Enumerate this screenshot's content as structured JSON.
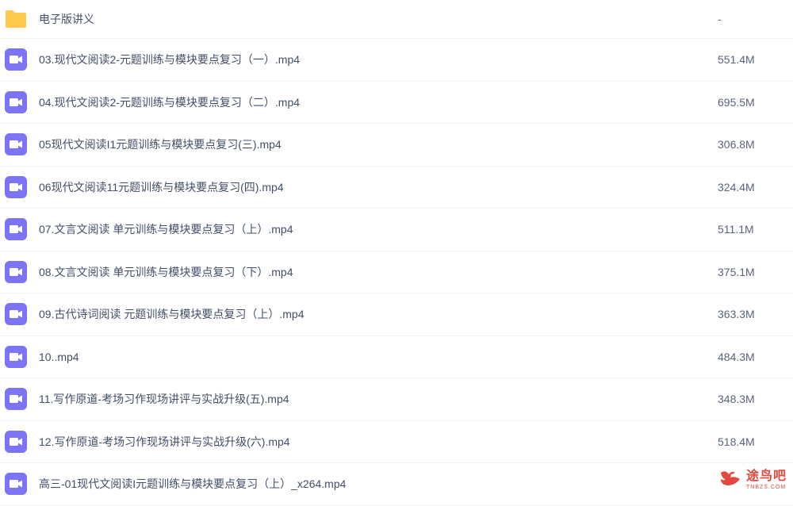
{
  "colors": {
    "folder": "#ffc94d",
    "video_icon": "#7b74f4",
    "text": "#424e67",
    "size_text": "#5a6478",
    "watermark": "#e2483c"
  },
  "files": [
    {
      "name": "电子版讲义",
      "size": "-",
      "icon": "folder-icon"
    },
    {
      "name": "03.现代文阅读2-元题训练与模块要点复习（一）.mp4",
      "size": "551.4M",
      "icon": "video-icon"
    },
    {
      "name": "04.现代文阅读2-元题训练与模块要点复习（二）.mp4",
      "size": "695.5M",
      "icon": "video-icon"
    },
    {
      "name": "05现代文阅读I1元题训练与模块要点复习(三).mp4",
      "size": "306.8M",
      "icon": "video-icon"
    },
    {
      "name": "06现代文阅读11元题训练与模块要点复习(四).mp4",
      "size": "324.4M",
      "icon": "video-icon"
    },
    {
      "name": "07.文言文阅读 单元训练与模块要点复习（上）.mp4",
      "size": "511.1M",
      "icon": "video-icon"
    },
    {
      "name": "08.文言文阅读 单元训练与模块要点复习（下）.mp4",
      "size": "375.1M",
      "icon": "video-icon"
    },
    {
      "name": "09.古代诗词阅读 元题训练与模块要点复习（上）.mp4",
      "size": "363.3M",
      "icon": "video-icon"
    },
    {
      "name": "10..mp4",
      "size": "484.3M",
      "icon": "video-icon"
    },
    {
      "name": "11.写作原道-考场习作现场讲评与实战升级(五).mp4",
      "size": "348.3M",
      "icon": "video-icon"
    },
    {
      "name": "12.写作原道-考场习作现场讲评与实战升级(六).mp4",
      "size": "518.4M",
      "icon": "video-icon"
    },
    {
      "name": "高三-01现代文阅读I元题训练与模块要点复习（上）_x264.mp4",
      "size": "",
      "icon": "video-icon"
    }
  ],
  "watermark": {
    "text": "途鸟吧",
    "sub": "TNBZS.COM"
  }
}
